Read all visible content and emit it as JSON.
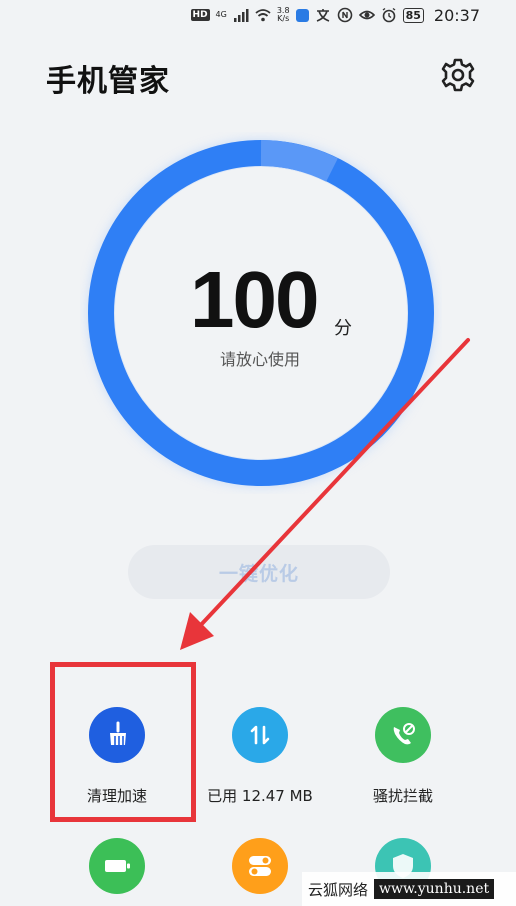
{
  "status_bar": {
    "hd_badge": "HD",
    "network": "4G",
    "speed_value": "3.8",
    "speed_unit": "K/s",
    "battery": "85",
    "time": "20:37"
  },
  "header": {
    "title": "手机管家"
  },
  "score": {
    "value": "100",
    "unit": "分",
    "description": "请放心使用"
  },
  "optimize_button": {
    "label": "一键优化"
  },
  "tools_row1": [
    {
      "label": "清理加速",
      "color": "#1f5fe0"
    },
    {
      "label": "已用 12.47 MB",
      "color": "#2aa8e8"
    },
    {
      "label": "骚扰拦截",
      "color": "#3fbf5f"
    }
  ],
  "tools_row2": [
    {
      "color": "#3cbf57"
    },
    {
      "color": "#ff9f1a"
    },
    {
      "color": "#3cc4b4"
    }
  ],
  "watermark": {
    "brand": "云狐网络",
    "url": "www.yunhu.net"
  },
  "colors": {
    "ring_blue": "#2f7ff5",
    "highlight_red": "#e8353a"
  }
}
